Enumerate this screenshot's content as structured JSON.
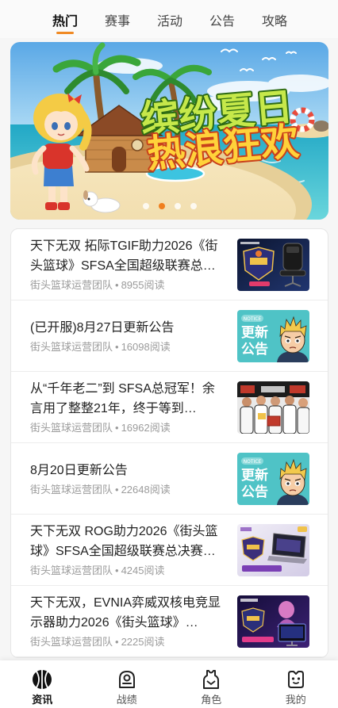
{
  "tabs": [
    {
      "label": "热门",
      "active": true
    },
    {
      "label": "赛事",
      "active": false
    },
    {
      "label": "活动",
      "active": false
    },
    {
      "label": "公告",
      "active": false
    },
    {
      "label": "攻略",
      "active": false
    }
  ],
  "banner": {
    "title_line1": "缤纷夏日",
    "title_line2": "热浪狂欢",
    "slide_count": 4,
    "active_slide": 2
  },
  "meta_separator": "•",
  "articles": [
    {
      "title": "天下无双 拓际TGIF助力2026《街头篮球》SFSA全国超级联赛总…",
      "author": "街头篮球运营团队",
      "reads": "8955阅读",
      "thumbnail": "gaming-chair-promo-image"
    },
    {
      "title": "(已开服)8月27日更新公告",
      "author": "街头篮球运营团队",
      "reads": "16098阅读",
      "thumbnail": "update-notice-image",
      "thumb_badge": "NOTICE",
      "thumb_line1": "更新",
      "thumb_line2": "公告"
    },
    {
      "title": "从“千年老二”到 SFSA总冠军！余言用了整整21年，终于等到…",
      "author": "街头篮球运营团队",
      "reads": "16962阅读",
      "thumbnail": "champion-team-photo"
    },
    {
      "title": "8月20日更新公告",
      "author": "街头篮球运营团队",
      "reads": "22648阅读",
      "thumbnail": "update-notice-image",
      "thumb_badge": "NOTICE",
      "thumb_line1": "更新",
      "thumb_line2": "公告"
    },
    {
      "title": "天下无双 ROG助力2026《街头篮球》SFSA全国超级联赛总决赛…",
      "author": "街头篮球运营团队",
      "reads": "4245阅读",
      "thumbnail": "rog-laptop-promo-image"
    },
    {
      "title": "天下无双，EVNIA弈威双核电竞显示器助力2026《街头篮球》…",
      "author": "街头篮球运营团队",
      "reads": "2225阅读",
      "thumbnail": "evnia-monitor-promo-image"
    }
  ],
  "bottom_nav": [
    {
      "label": "资讯",
      "icon": "basketball-icon",
      "active": true
    },
    {
      "label": "战绩",
      "icon": "record-icon",
      "active": false
    },
    {
      "label": "角色",
      "icon": "jersey-icon",
      "active": false
    },
    {
      "label": "我的",
      "icon": "profile-face-icon",
      "active": false
    }
  ],
  "colors": {
    "accent": "#f08a24",
    "text_primary": "#222222",
    "text_secondary": "#9b9b9b",
    "notice_teal": "#4fc3c6"
  }
}
